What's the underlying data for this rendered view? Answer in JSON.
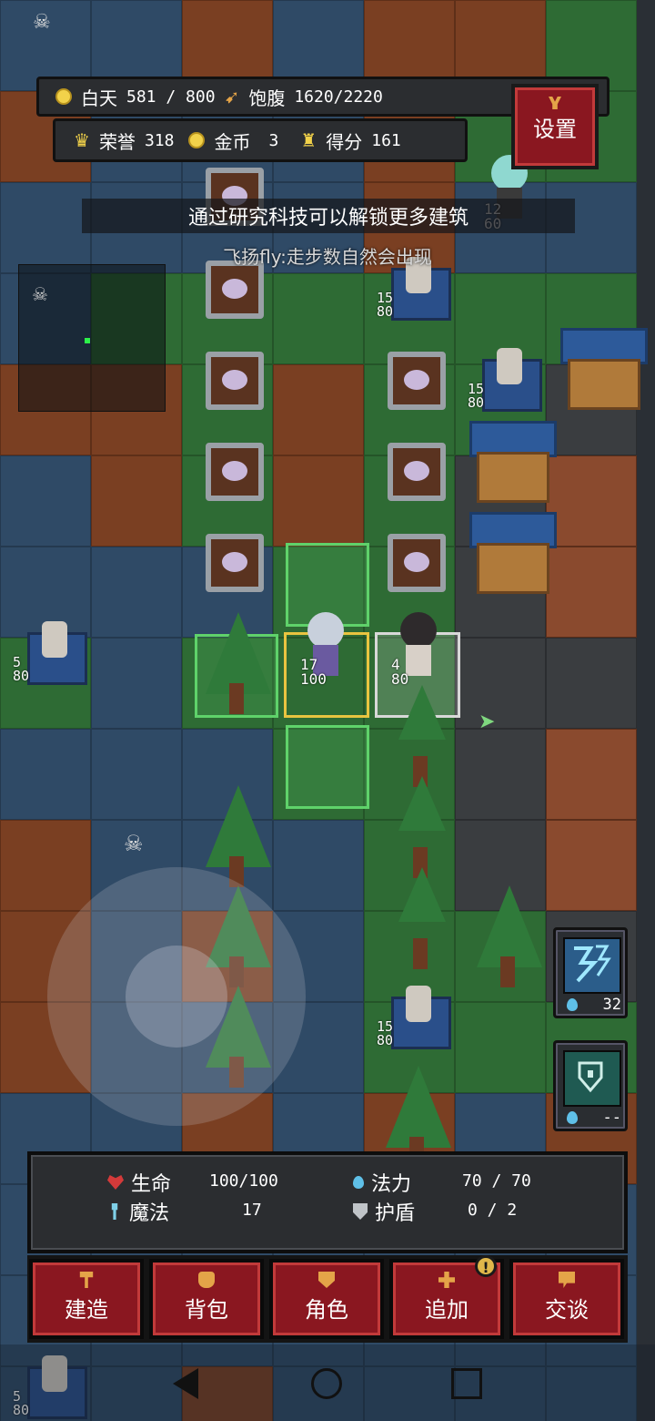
{
  "hud": {
    "day_label": "白天",
    "day_value": "581",
    "day_sep": "/",
    "day_max": "800",
    "hunger_label": "饱腹",
    "hunger_value": "1620/2220",
    "honor_label": "荣誉",
    "honor_value": "318",
    "gold_label": "金币",
    "gold_value": "3",
    "score_label": "得分",
    "score_value": "161",
    "settings_label": "设置"
  },
  "messages": {
    "tip": "通过研究科技可以解锁更多建筑",
    "chat": "飞扬fly:走步数自然会出现"
  },
  "units": {
    "hero_stat_top": "17",
    "hero_stat_hp": "100",
    "ally_stat_top": "4",
    "ally_stat_hp": "80",
    "enemy_stat_top": "12",
    "enemy_stat_hp": "60",
    "tower_top": "15",
    "tower_hp": "80",
    "tower_left_top": "5",
    "tower_left_hp": "80"
  },
  "skills": [
    {
      "icon": "lightning-rune-icon",
      "cost": "32"
    },
    {
      "icon": "shield-rune-icon",
      "cost": "--"
    }
  ],
  "stats": {
    "hp_label": "生命",
    "hp_value": "100/100",
    "mp_label": "法力",
    "mp_value": "70 / 70",
    "magic_label": "魔法",
    "magic_value": "17",
    "shield_label": "护盾",
    "shield_value": "0 / 2"
  },
  "buttons": {
    "build": "建造",
    "bag": "背包",
    "role": "角色",
    "add": "追加",
    "add_badge": "!",
    "talk": "交谈"
  },
  "colors": {
    "button_red": "#8a1720",
    "panel": "#2b2d30",
    "gold": "#f2d24a"
  }
}
